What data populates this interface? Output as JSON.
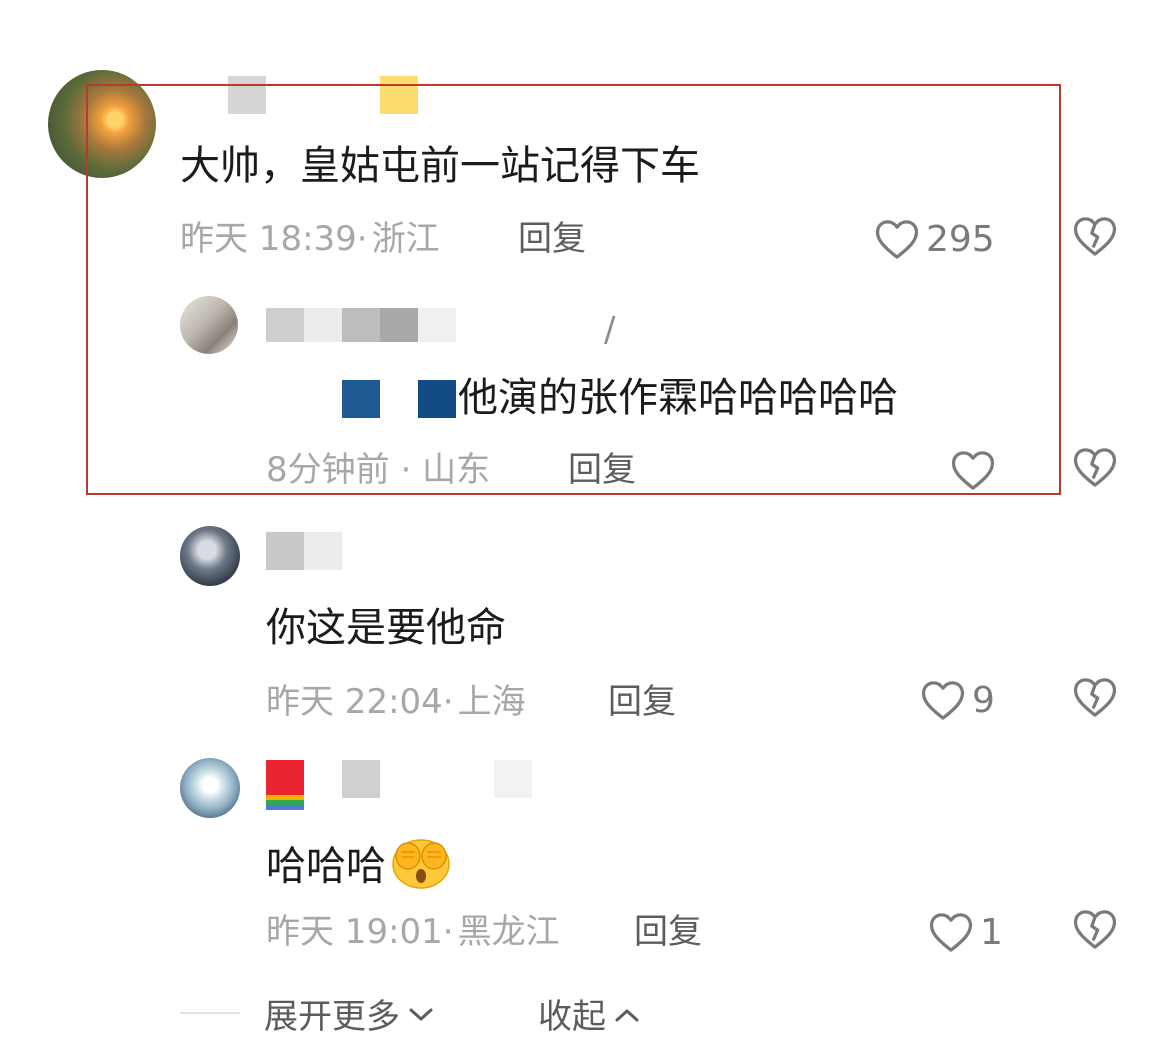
{
  "comments": [
    {
      "text": "大帅，皇姑屯前一站记得下车",
      "time": "昨天 18:39",
      "location": "浙江",
      "reply_label": "回复",
      "likes": "295"
    },
    {
      "reply_to_separator": "/",
      "text": "他演的张作霖哈哈哈哈哈",
      "time": "8分钟前",
      "location": "山东",
      "reply_label": "回复",
      "likes": ""
    },
    {
      "text": "你这是要他命",
      "time": "昨天 22:04",
      "location": "上海",
      "reply_label": "回复",
      "likes": "9"
    },
    {
      "text": "哈哈哈",
      "time": "昨天 19:01",
      "location": "黑龙江",
      "reply_label": "回复",
      "likes": "1"
    }
  ],
  "meta_separator": "·",
  "footer": {
    "expand_label": "展开更多",
    "collapse_label": "收起"
  },
  "colors": {
    "highlight_border": "#b73a2c",
    "meta_text": "#a7a7a7",
    "reply_text": "#5c5c5c",
    "main_text": "#1b1b1b",
    "icon": "#7a7a7a"
  },
  "icons": {
    "like": "heart-outline-icon",
    "dislike": "broken-heart-icon",
    "expand": "chevron-down-icon",
    "collapse": "chevron-up-icon",
    "emoji": "face-with-hands-over-eyes-emoji"
  }
}
